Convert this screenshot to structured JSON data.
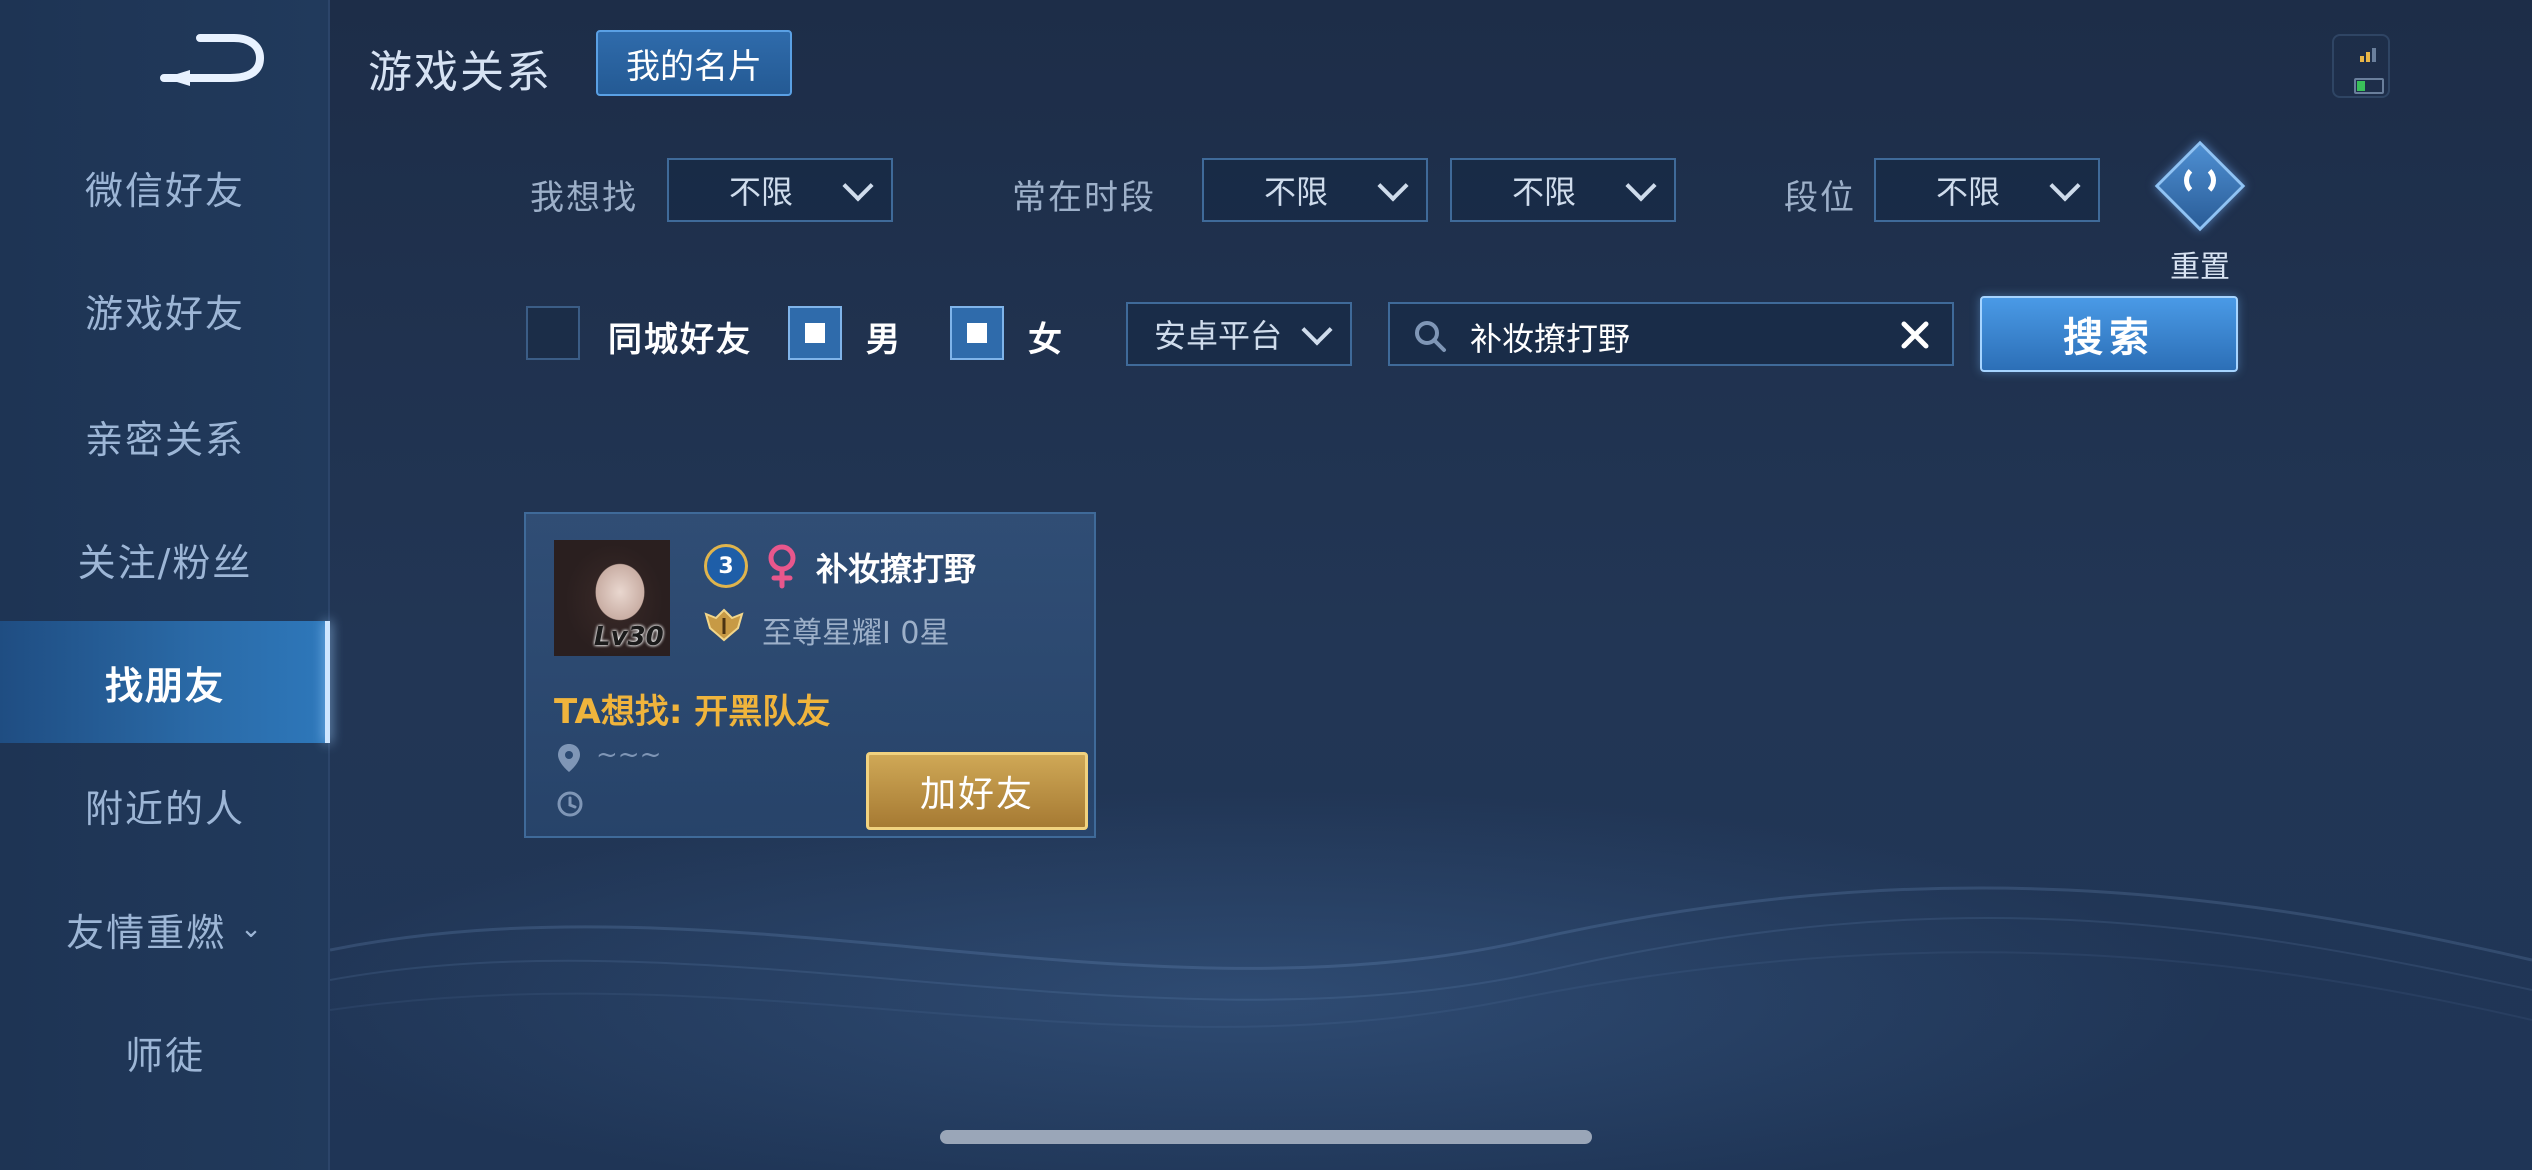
{
  "header": {
    "title": "游戏关系",
    "my_card_label": "我的名片"
  },
  "sidebar": {
    "items": [
      {
        "label": "微信好友"
      },
      {
        "label": "游戏好友"
      },
      {
        "label": "亲密关系"
      },
      {
        "label": "关注/粉丝"
      },
      {
        "label": "找朋友",
        "active": true
      },
      {
        "label": "附近的人"
      },
      {
        "label": "友情重燃",
        "has_chevron": true
      },
      {
        "label": "师徒"
      }
    ]
  },
  "filters": {
    "looking_for": {
      "label": "我想找",
      "value": "不限"
    },
    "active_period": {
      "label": "常在时段",
      "value_start": "不限",
      "value_end": "不限"
    },
    "rank": {
      "label": "段位",
      "value": "不限"
    },
    "reset_label": "重置",
    "same_city": {
      "label": "同城好友",
      "checked": false
    },
    "male": {
      "label": "男",
      "checked": true
    },
    "female": {
      "label": "女",
      "checked": true
    },
    "platform": {
      "value": "安卓平台"
    },
    "search": {
      "value": "补妆撩打野"
    },
    "search_button": "搜索"
  },
  "results": [
    {
      "level": "3",
      "avatar_level": "Lv30",
      "gender_icon": "female-icon",
      "name": "补妆撩打野",
      "rank": "至尊星耀I 0星",
      "wants": "TA想找: 开黑队友",
      "location": "~~~",
      "add_button": "加好友"
    }
  ],
  "colors": {
    "accent_blue": "#2f6bab",
    "gold": "#f0b43c",
    "background": "#223655"
  }
}
